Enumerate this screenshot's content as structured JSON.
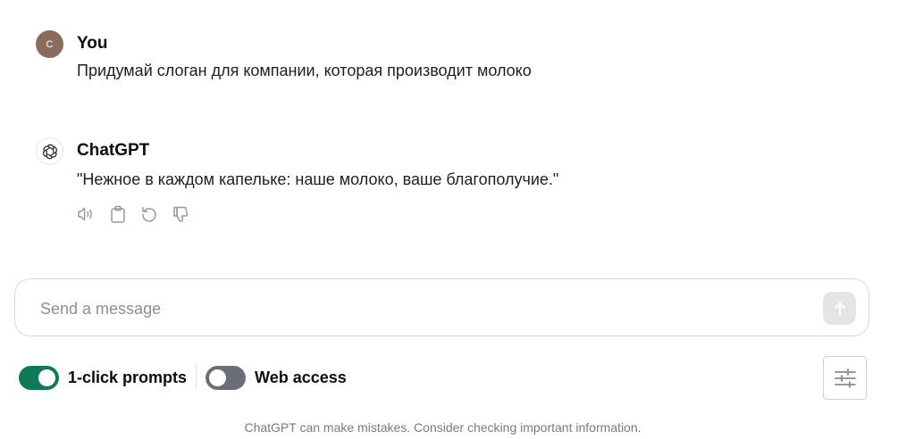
{
  "conversation": {
    "user": {
      "avatar_letter": "C",
      "name": "You",
      "message": "Придумай слоган для компании, которая производит молоко"
    },
    "assistant": {
      "name": "ChatGPT",
      "message": "\"Нежное в каждом капельке: наше молоко, ваше благополучие.\"",
      "actions": [
        "speaker-icon",
        "clipboard-icon",
        "regenerate-icon",
        "thumbs-down-icon"
      ]
    }
  },
  "composer": {
    "placeholder": "Send a message",
    "value": ""
  },
  "toggles": {
    "one_click_prompts": {
      "label": "1-click prompts",
      "on": true
    },
    "web_access": {
      "label": "Web access",
      "on": false
    }
  },
  "footer": {
    "disclaimer": "ChatGPT can make mistakes. Consider checking important information."
  },
  "colors": {
    "toggle_on": "#0f7a5a",
    "toggle_off": "#6b6e76",
    "user_avatar": "#8a6b5e"
  }
}
